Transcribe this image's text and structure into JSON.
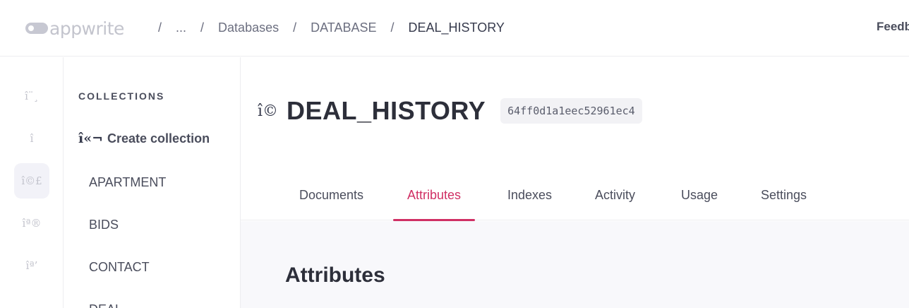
{
  "header": {
    "logo_text": "appwrite",
    "breadcrumbs": [
      {
        "sep": "/",
        "label": "..."
      },
      {
        "sep": "/",
        "label": "Databases"
      },
      {
        "sep": "/",
        "label": "DATABASE"
      },
      {
        "sep": "/",
        "label": "DEAL_HISTORY"
      }
    ],
    "feedback_label": "Feedb"
  },
  "rail": {
    "items": [
      {
        "icon": "î¨¸",
        "name": "overview-icon"
      },
      {
        "icon": "î",
        "name": "auth-icon"
      },
      {
        "icon": "î©£",
        "name": "databases-icon"
      },
      {
        "icon": "îª®",
        "name": "functions-icon"
      },
      {
        "icon": "îª’",
        "name": "storage-icon"
      }
    ]
  },
  "collections": {
    "title": "COLLECTIONS",
    "create_icon": "î«¬",
    "create_label": "Create collection",
    "items": [
      "APARTMENT",
      "BIDS",
      "CONTACT",
      "DEAL"
    ]
  },
  "main": {
    "title_icon": "î©",
    "title": "DEAL_HISTORY",
    "id": "64ff0d1a1eec52961ec4",
    "tabs": [
      "Documents",
      "Attributes",
      "Indexes",
      "Activity",
      "Usage",
      "Settings"
    ],
    "active_tab": "Attributes",
    "section_title": "Attributes"
  },
  "colors": {
    "accent": "#d02f64",
    "text": "#373b4d",
    "muted": "#c3c4cd"
  }
}
